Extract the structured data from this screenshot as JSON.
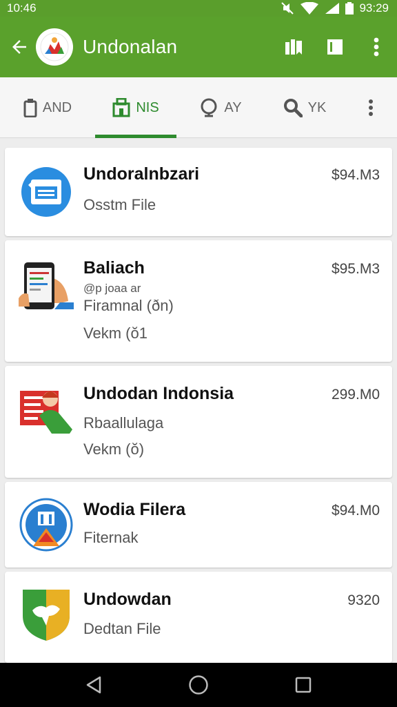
{
  "status_bar": {
    "time": "10:46",
    "clock_right": "93:29",
    "icons": [
      "mute-icon",
      "wifi-icon",
      "signal-icon",
      "battery-icon"
    ]
  },
  "app_bar": {
    "title": "Undonalan",
    "actions": [
      "bookmark-icon",
      "square-icon",
      "overflow-menu-icon"
    ]
  },
  "tabs": [
    {
      "label": "AND",
      "icon": "clipboard-icon",
      "active": false
    },
    {
      "label": "NIS",
      "icon": "storefront-icon",
      "active": true
    },
    {
      "label": "AY",
      "icon": "pin-icon",
      "active": false
    },
    {
      "label": "YK",
      "icon": "search-icon",
      "active": false
    }
  ],
  "items": [
    {
      "title": "Undoralnbzari",
      "size": "$94.M3",
      "lines": [
        "Osstm File"
      ],
      "icon": "document-icon"
    },
    {
      "title": "Baliach",
      "size": "$95.M3",
      "lines": [
        "@p joaa ar",
        "Firamnal (ðn)",
        "Vekm (ŏ1"
      ],
      "icon": "phone-icon"
    },
    {
      "title": "Undodan Indonsia",
      "size": "299.M0",
      "lines": [
        "Rbaallulaga",
        "Vekm (ŏ)"
      ],
      "icon": "flag-person-icon"
    },
    {
      "title": "Wodia Filera",
      "size": "$94.M0",
      "lines": [
        "Fiternak"
      ],
      "icon": "emblem-icon"
    },
    {
      "title": "Undowdan",
      "size": "9320",
      "lines": [
        "Dedtan File"
      ],
      "icon": "shield-icon"
    }
  ],
  "colors": {
    "primary": "#5aa12c",
    "accent": "#2e8b2e",
    "background": "#ededed"
  }
}
